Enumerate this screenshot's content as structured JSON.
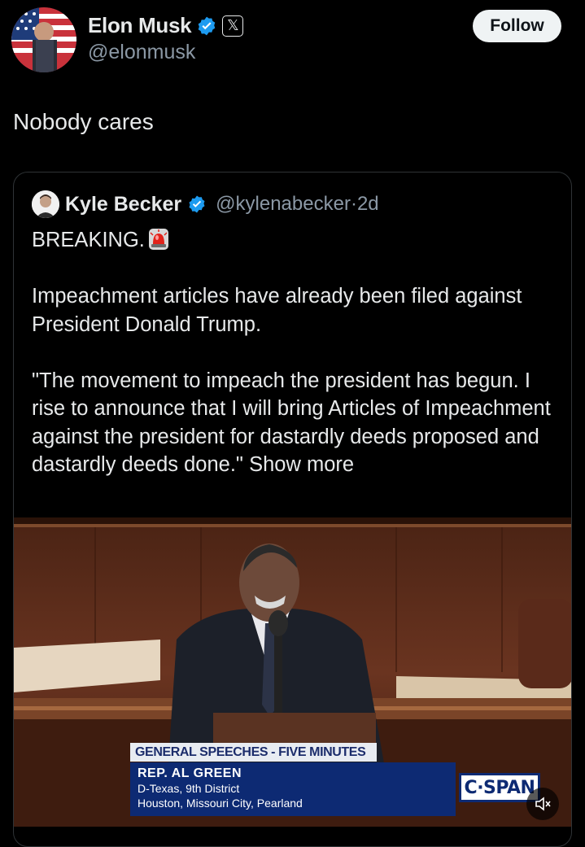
{
  "author": {
    "display_name": "Elon Musk",
    "handle": "@elonmusk",
    "affiliate_badge": "𝕏"
  },
  "follow_label": "Follow",
  "tweet_text": "Nobody cares",
  "quoted": {
    "display_name": "Kyle Becker",
    "handle": "@kylenabecker",
    "separator": "·",
    "time": "2d",
    "breaking": "BREAKING.",
    "paragraph1": "Impeachment articles have already been filed against President Donald Trump.",
    "paragraph2": "\"The movement to impeach the president has begun. I rise to announce that I will bring Articles of Impeachment against the president for dastardly deeds proposed and dastardly deeds done.\"",
    "show_more": "Show more",
    "media": {
      "chyron_title": "GENERAL SPEECHES - FIVE MINUTES",
      "chyron_name": "REP. AL GREEN",
      "chyron_district": "D-Texas, 9th District",
      "chyron_cities": "Houston, Missouri City, Pearland",
      "network_logo": "C·SPAN"
    }
  },
  "colors": {
    "background": "#000000",
    "verified_blue": "#1d9bf0",
    "cspan_blue": "#0d2a73"
  },
  "icons": {
    "verified": "verified-badge-icon",
    "siren": "rotating-light-icon",
    "mute": "speaker-muted-icon"
  }
}
